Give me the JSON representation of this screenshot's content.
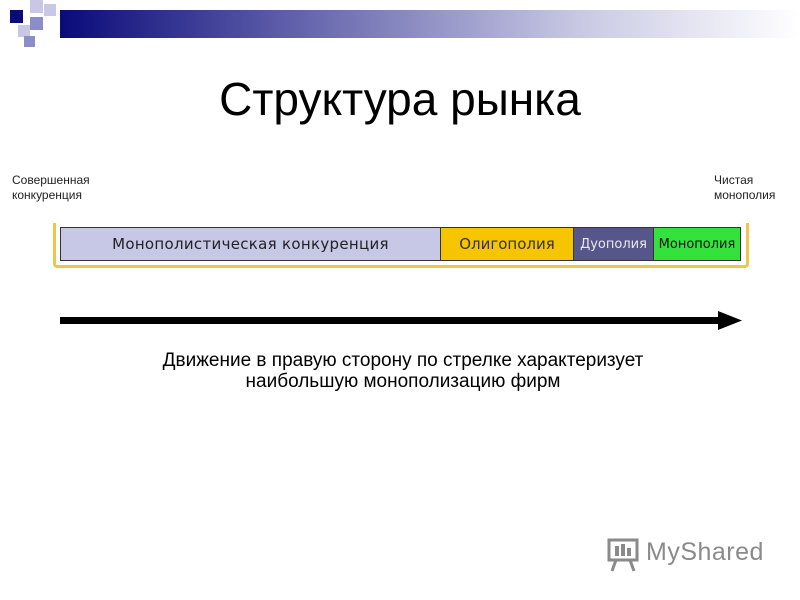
{
  "title": "Структура рынка",
  "end_labels": {
    "left": "Совершенная\nконкуренция",
    "right": "Чистая\nмонополия"
  },
  "segments": [
    {
      "label": "Монополистическая  конкуренция",
      "color": "#c6c8e6"
    },
    {
      "label": "Олигополия",
      "color": "#f6c500"
    },
    {
      "label": "Дуополия",
      "color": "#56568a"
    },
    {
      "label": "Монополия",
      "color": "#33e33c"
    }
  ],
  "caption_lines": [
    "Движение в правую сторону по стрелке характеризует",
    "наибольшую монополизацию фирм"
  ],
  "watermark": "MyShared",
  "colors": {
    "accent_dark": "#0a0a7a",
    "bracket": "#f0c64a",
    "arrow": "#000000"
  }
}
